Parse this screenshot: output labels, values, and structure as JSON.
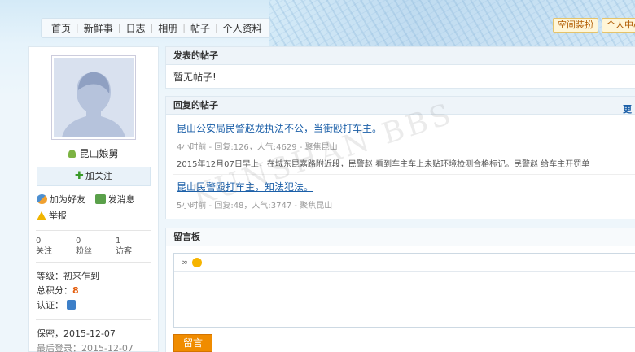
{
  "nav": {
    "items": [
      "首页",
      "新鲜事",
      "日志",
      "相册",
      "帖子",
      "个人资料"
    ]
  },
  "top_buttons": {
    "decorate": "空间装扮",
    "personal_center": "个人中心"
  },
  "profile": {
    "username": "昆山娘舅",
    "follow_label": "加关注",
    "add_friend": "加为好友",
    "send_message": "发消息",
    "report": "举报",
    "stats": [
      {
        "value": "0",
        "label": "关注"
      },
      {
        "value": "0",
        "label": "粉丝"
      },
      {
        "value": "1",
        "label": "访客"
      }
    ],
    "level_label": "等级：",
    "level_value": "初来乍到",
    "points_label": "总积分：",
    "points_value": "8",
    "cert_label": "认证：",
    "secret_line": "保密，2015-12-07",
    "last_login_label": "最后登录：",
    "last_login_value": "2015-12-07"
  },
  "posted": {
    "title": "发表的帖子",
    "empty_text": "暂无帖子!"
  },
  "replied": {
    "title": "回复的帖子",
    "more": "更",
    "posts": [
      {
        "title": "昆山公安局民警赵龙执法不公，当街殴打车主。",
        "meta": "4小时前 - 回复:126，人气:4629 - 聚焦昆山",
        "snippet": "2015年12月07日早上，在城东昆嘉路附近段，民警赵 看到车主车上未贴环境检测合格标记。民警赵 给车主开罚单"
      },
      {
        "title": "昆山民警殴打车主，知法犯法。",
        "meta": "5小时前 - 回复:48，人气:3747 - 聚焦昆山",
        "snippet": ""
      }
    ]
  },
  "guestbook": {
    "title": "留言板",
    "submit_label": "留言"
  },
  "watermark": "KUNSHAN BBS",
  "colors": {
    "link": "#1b5fa8",
    "accent_orange": "#f08c00",
    "points_red": "#e35d0c"
  }
}
